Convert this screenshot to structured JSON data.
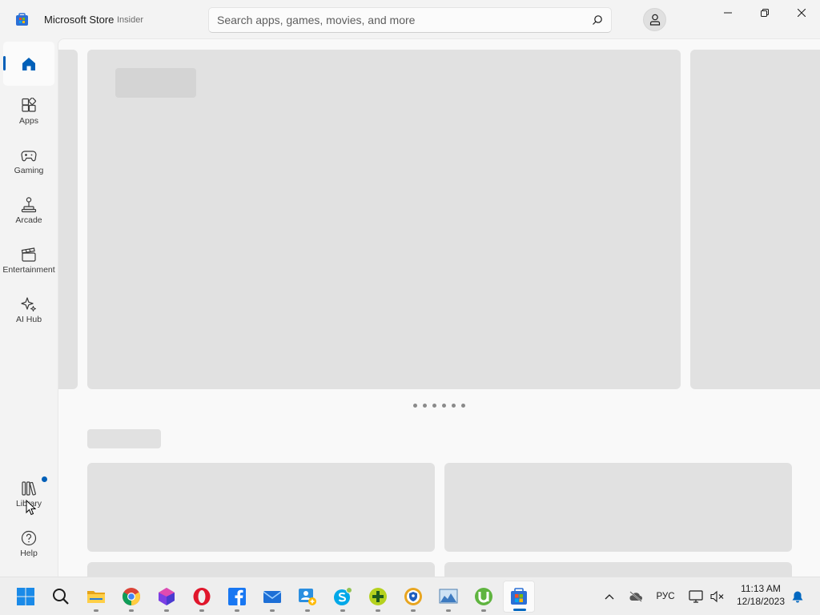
{
  "window": {
    "title": "Microsoft Store",
    "badge": "Insider",
    "controls": [
      "minimize-icon",
      "restore-icon",
      "close-icon"
    ]
  },
  "search": {
    "placeholder": "Search apps, games, movies, and more",
    "value": ""
  },
  "sidebar": {
    "items": [
      {
        "id": "home",
        "label": "",
        "icon": "home-icon",
        "selected": true
      },
      {
        "id": "apps",
        "label": "Apps",
        "icon": "apps-icon"
      },
      {
        "id": "gaming",
        "label": "Gaming",
        "icon": "gamepad-icon"
      },
      {
        "id": "arcade",
        "label": "Arcade",
        "icon": "joystick-icon"
      },
      {
        "id": "entertainment",
        "label": "Entertainment",
        "icon": "clapperboard-icon"
      },
      {
        "id": "ai-hub",
        "label": "AI Hub",
        "icon": "sparkle-icon"
      }
    ],
    "bottom_items": [
      {
        "id": "library",
        "label": "Library",
        "icon": "library-icon",
        "has_notification_dot": true
      },
      {
        "id": "help",
        "label": "Help",
        "icon": "help-icon"
      }
    ]
  },
  "main": {
    "state": "loading-skeleton",
    "hero_carousel_dots": 6
  },
  "taskbar": {
    "apps": [
      "start-icon",
      "search-icon",
      "file-explorer-icon",
      "chrome-icon",
      "gem-app-icon",
      "opera-icon",
      "facebook-icon",
      "mail-icon",
      "contacts-icon",
      "skype-icon",
      "plus-app-icon",
      "shield-app-icon",
      "image-viewer-icon",
      "utorrent-icon",
      "microsoft-store-icon"
    ],
    "active_app": "microsoft-store-icon",
    "tray": {
      "language": "РУС",
      "time": "11:13 AM",
      "date": "12/18/2023"
    }
  },
  "colors": {
    "accent": "#005fb8",
    "skeleton": "#e1e1e1",
    "background": "#f3f3f3"
  }
}
